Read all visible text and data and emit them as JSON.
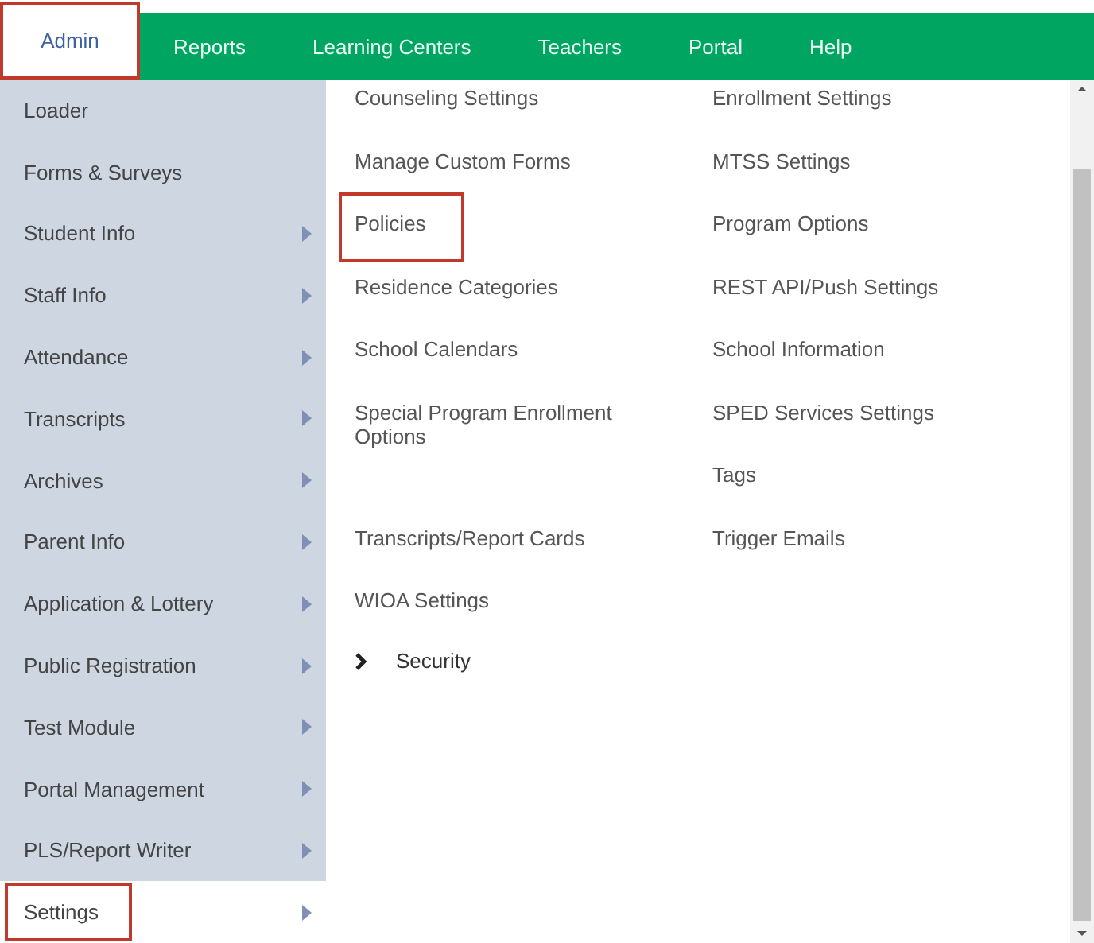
{
  "nav_tabs": [
    {
      "label": "Admin",
      "selected": true,
      "highlighted": true
    },
    {
      "label": "Reports",
      "selected": false,
      "highlighted": false
    },
    {
      "label": "Learning Centers",
      "selected": false,
      "highlighted": false
    },
    {
      "label": "Teachers",
      "selected": false,
      "highlighted": false
    },
    {
      "label": "Portal",
      "selected": false,
      "highlighted": false
    },
    {
      "label": "Help",
      "selected": false,
      "highlighted": false
    }
  ],
  "admin_menu": [
    {
      "label": "Loader",
      "submenu": false,
      "selected": false,
      "highlighted": false
    },
    {
      "label": "Forms & Surveys",
      "submenu": false,
      "selected": false,
      "highlighted": false
    },
    {
      "label": "Student Info",
      "submenu": true,
      "selected": false,
      "highlighted": false
    },
    {
      "label": "Staff Info",
      "submenu": true,
      "selected": false,
      "highlighted": false
    },
    {
      "label": "Attendance",
      "submenu": true,
      "selected": false,
      "highlighted": false
    },
    {
      "label": "Transcripts",
      "submenu": true,
      "selected": false,
      "highlighted": false
    },
    {
      "label": "Archives",
      "submenu": true,
      "selected": false,
      "highlighted": false
    },
    {
      "label": "Parent Info",
      "submenu": true,
      "selected": false,
      "highlighted": false
    },
    {
      "label": "Application & Lottery",
      "submenu": true,
      "selected": false,
      "highlighted": false
    },
    {
      "label": "Public Registration",
      "submenu": true,
      "selected": false,
      "highlighted": false
    },
    {
      "label": "Test Module",
      "submenu": true,
      "selected": false,
      "highlighted": false
    },
    {
      "label": "Portal Management",
      "submenu": true,
      "selected": false,
      "highlighted": false
    },
    {
      "label": "PLS/Report Writer",
      "submenu": true,
      "selected": false,
      "highlighted": false
    },
    {
      "label": "Settings",
      "submenu": true,
      "selected": true,
      "highlighted": true
    }
  ],
  "settings_panel": {
    "columns": [
      [
        {
          "label": "Counseling Settings",
          "kind": "link",
          "highlighted": false
        },
        {
          "label": "Manage Custom Forms",
          "kind": "link",
          "highlighted": false
        },
        {
          "label": "Policies",
          "kind": "link",
          "highlighted": true
        },
        {
          "label": "Residence Categories",
          "kind": "link",
          "highlighted": false
        },
        {
          "label": "School Calendars",
          "kind": "link",
          "highlighted": false
        },
        {
          "label": "Special Program Enrollment Options",
          "kind": "link",
          "highlighted": false
        },
        {
          "label": "Transcripts/Report Cards",
          "kind": "link",
          "highlighted": false
        },
        {
          "label": "WIOA Settings",
          "kind": "link",
          "highlighted": false
        },
        {
          "label": "Security",
          "kind": "group",
          "highlighted": false
        }
      ],
      [
        {
          "label": "Enrollment Settings",
          "kind": "link",
          "highlighted": false
        },
        {
          "label": "MTSS Settings",
          "kind": "link",
          "highlighted": false
        },
        {
          "label": "Program Options",
          "kind": "link",
          "highlighted": false
        },
        {
          "label": "REST API/Push Settings",
          "kind": "link",
          "highlighted": false
        },
        {
          "label": "School Information",
          "kind": "link",
          "highlighted": false
        },
        {
          "label": "SPED Services Settings",
          "kind": "link",
          "highlighted": false
        },
        {
          "label": "Tags",
          "kind": "link",
          "highlighted": false
        },
        {
          "label": "Trigger Emails",
          "kind": "link",
          "highlighted": false
        }
      ]
    ]
  }
}
